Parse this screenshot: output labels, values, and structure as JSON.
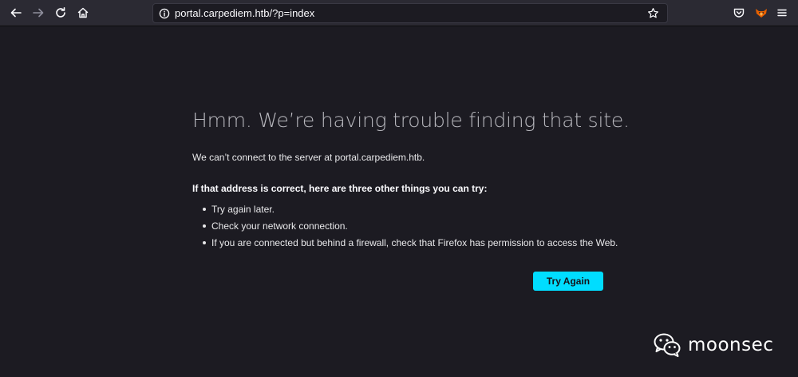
{
  "browser": {
    "url": "portal.carpediem.htb/?p=index",
    "icons": {
      "back": "back-arrow-icon",
      "forward": "forward-arrow-icon",
      "reload": "reload-icon",
      "home": "home-icon",
      "info": "info-icon",
      "bookmark": "star-icon",
      "pocket": "pocket-icon",
      "extension": "fox-extension-icon",
      "menu": "hamburger-menu-icon"
    }
  },
  "error_page": {
    "title": "Hmm. We’re having trouble finding that site.",
    "description": "We can’t connect to the server at portal.carpediem.htb.",
    "tips_heading": "If that address is correct, here are three other things you can try:",
    "tips": [
      "Try again later.",
      "Check your network connection.",
      "If you are connected but behind a firewall, check that Firefox has permission to access the Web."
    ],
    "try_again_label": "Try Again"
  },
  "watermark": {
    "text": "moonsec",
    "icon": "wechat-icon"
  },
  "colors": {
    "page_background": "#1c1b22",
    "toolbar_background": "#2b2a33",
    "accent_button": "#00ddff",
    "title_text": "#b7b7bd"
  }
}
